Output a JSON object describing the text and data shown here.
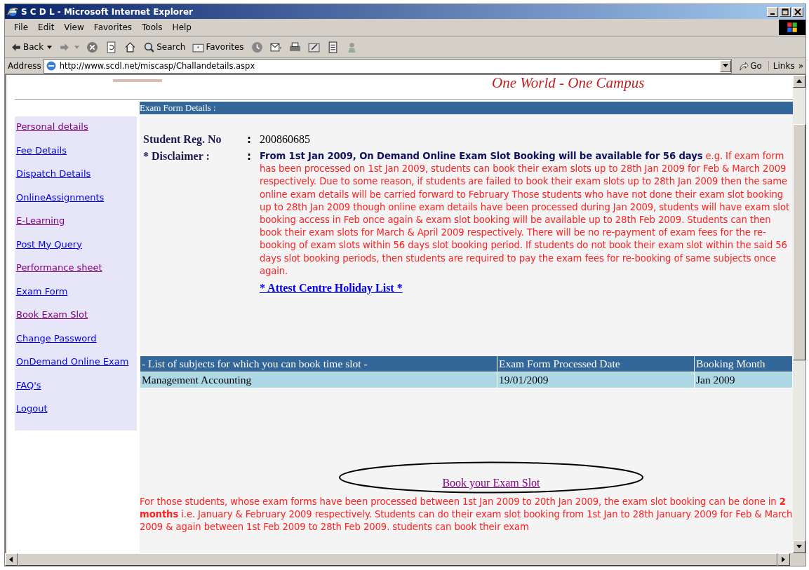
{
  "window": {
    "title": "S C D L - Microsoft Internet Explorer"
  },
  "menu": [
    "File",
    "Edit",
    "View",
    "Favorites",
    "Tools",
    "Help"
  ],
  "toolbar": [
    {
      "kind": "back",
      "label": "Back"
    },
    {
      "kind": "forward"
    },
    {
      "kind": "stop"
    },
    {
      "kind": "refresh"
    },
    {
      "kind": "home"
    },
    {
      "kind": "search",
      "label": "Search"
    },
    {
      "kind": "favorites",
      "label": "Favorites"
    },
    {
      "kind": "history"
    },
    {
      "kind": "mail"
    },
    {
      "kind": "print"
    },
    {
      "kind": "edit"
    },
    {
      "kind": "discuss"
    },
    {
      "kind": "messenger"
    }
  ],
  "address": {
    "label": "Address",
    "value": "http://www.scdl.net/miscasp/Challandetails.aspx",
    "go": "Go",
    "links": "Links",
    "more": "»"
  },
  "page": {
    "tagline": "One World - One Campus",
    "nav": [
      {
        "label": "Personal details",
        "visited": true
      },
      {
        "label": "Fee Details",
        "visited": false
      },
      {
        "label": "Dispatch Details",
        "visited": false
      },
      {
        "label": "OnlineAssignments",
        "visited": false
      },
      {
        "label": "E-Learning",
        "visited": true
      },
      {
        "label": "Post My Query",
        "visited": false
      },
      {
        "label": "Performance sheet",
        "visited": true
      },
      {
        "label": "Exam Form",
        "visited": false
      },
      {
        "label": "Book Exam Slot",
        "visited": true
      },
      {
        "label": "Change Password",
        "visited": false
      },
      {
        "label": "OnDemand Online Exam",
        "visited": false
      },
      {
        "label": "FAQ's",
        "visited": false
      },
      {
        "label": "Logout",
        "visited": false
      }
    ],
    "section_title": "Exam Form Details :",
    "reg_no": {
      "label": "Student Reg. No",
      "sep": ":",
      "value": "200860685"
    },
    "disclaimer": {
      "label": "* Disclaimer :",
      "sep": ":",
      "text": "**From 1st Jan 2009, On Demand Online Exam Slot Booking will be available for 56 days** e.g. If exam form has been processed on 1st Jan 2009, students can book their exam slots up to 28th Jan 2009 for Feb & March 2009 respectively. Due to some reason, if students are failed to book their exam slots up to 28th Jan 2009 then the same online exam details will be carried forward to February Those students who have not done their exam slot booking up to 28th Jan 2009 though online exam details have been processed during Jan 2009, students will have exam slot booking access in Feb once again & exam slot booking will be available up to 28th Feb 2009. Students can then book their exam slots for March & April 2009 respectively. There will be no re-payment of exam fees for the re-booking of exam slots within 56 days slot booking period. If students do not book their exam slot within the said 56 days slot booking periods, then students are required to pay the exam fees for re-booking of same subjects once again."
    },
    "holiday_link": "* Attest Centre Holiday List *",
    "table": {
      "columns": [
        "- List of subjects for which you can book time slot -",
        "Exam Form Processed Date",
        "Booking Month"
      ],
      "rows": [
        [
          "Management Accounting",
          "19/01/2009",
          "Jan 2009"
        ]
      ]
    },
    "book_link": "Book your Exam Slot",
    "note": "For those students, whose exam forms have been processed between 1st Jan 2009 to 20th Jan 2009, the exam slot booking can be done in **2 months** i.e. January & February 2009 respectively. Students can do their exam slot booking from 1st Jan to 28th January 2009 for Feb & March 2009 & again between 1st Feb 2009 to 28th Feb 2009. students can book their exam"
  }
}
